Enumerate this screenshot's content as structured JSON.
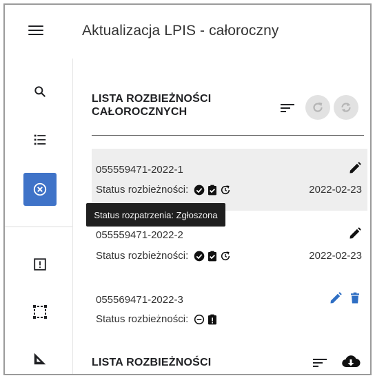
{
  "header": {
    "title": "Aktualizacja LPIS - całoroczny"
  },
  "sidebar": {
    "items": [
      {
        "name": "search",
        "icon": "search-icon"
      },
      {
        "name": "list",
        "icon": "list-icon"
      },
      {
        "name": "discrepancies",
        "icon": "cancel-circle-icon",
        "active": true
      },
      {
        "name": "report",
        "icon": "alert-box-icon"
      },
      {
        "name": "select-area",
        "icon": "select-frame-icon"
      },
      {
        "name": "measure",
        "icon": "ruler-triangle-icon"
      }
    ]
  },
  "year_round": {
    "title_line1": "LISTA ROZBIEŻNOŚCI",
    "title_line2": "CAŁOROCZNYCH",
    "status_label": "Status rozbieżności:",
    "items": [
      {
        "id": "055559471-2022-1",
        "date": "2022-02-23",
        "status_icons": [
          "check-circle-icon",
          "clipboard-check-icon",
          "history-icon"
        ],
        "actions": [
          "edit-icon"
        ]
      },
      {
        "id": "055559471-2022-2",
        "date": "2022-02-23",
        "status_icons": [
          "check-circle-icon",
          "clipboard-check-icon",
          "history-icon"
        ],
        "actions": [
          "edit-icon"
        ]
      },
      {
        "id": "055569471-2022-3",
        "date": "",
        "status_icons": [
          "minus-circle-icon",
          "clipboard-alert-icon"
        ],
        "actions": [
          "edit-icon",
          "delete-icon"
        ]
      }
    ]
  },
  "tooltip": {
    "text": "Status rozpatrzenia: Zgłoszona"
  },
  "all_list": {
    "title": "LISTA ROZBIEŻNOŚCI"
  },
  "colors": {
    "accent": "#3f73c8",
    "edit_active": "#2f6fc4",
    "highlight": "#eeeeee",
    "tooltip_bg": "#1f1f1f"
  }
}
